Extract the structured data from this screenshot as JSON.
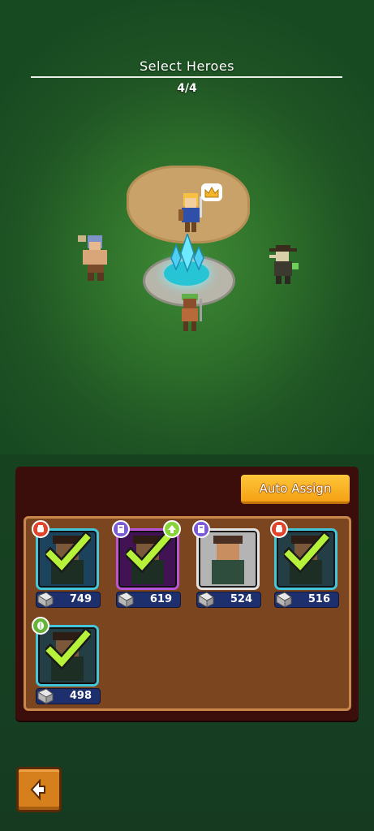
{
  "header": {
    "title": "Select Heroes",
    "count": "4/4"
  },
  "panel": {
    "auto_assign_label": "Auto Assign",
    "heroes": [
      {
        "power": "749",
        "class_icon": "fist-icon",
        "class_color": "#e0442a",
        "selected": true,
        "bg": "#2d6c98",
        "frame": "#43c6d9",
        "upgrade": false
      },
      {
        "power": "619",
        "class_icon": "book-icon",
        "class_color": "#7a5ad8",
        "selected": true,
        "bg": "#6a1f88",
        "frame": "#bb55d8",
        "upgrade": true
      },
      {
        "power": "524",
        "class_icon": "book-icon",
        "class_color": "#7a5ad8",
        "selected": false,
        "bg": "#b4b4b4",
        "frame": "#e3e3e3",
        "upgrade": false
      },
      {
        "power": "516",
        "class_icon": "fist-icon",
        "class_color": "#e0442a",
        "selected": true,
        "bg": "#3a6470",
        "frame": "#43c6d9",
        "upgrade": false
      },
      {
        "power": "498",
        "class_icon": "leaf-icon",
        "class_color": "#67b43a",
        "selected": true,
        "bg": "#3a6470",
        "frame": "#43c6d9",
        "upgrade": false
      }
    ]
  },
  "nav": {
    "back_icon": "back-arrow-icon"
  },
  "colors": {
    "accent": "#f4a114",
    "panel": "#3b0e0b",
    "check": "#b7f23a"
  }
}
